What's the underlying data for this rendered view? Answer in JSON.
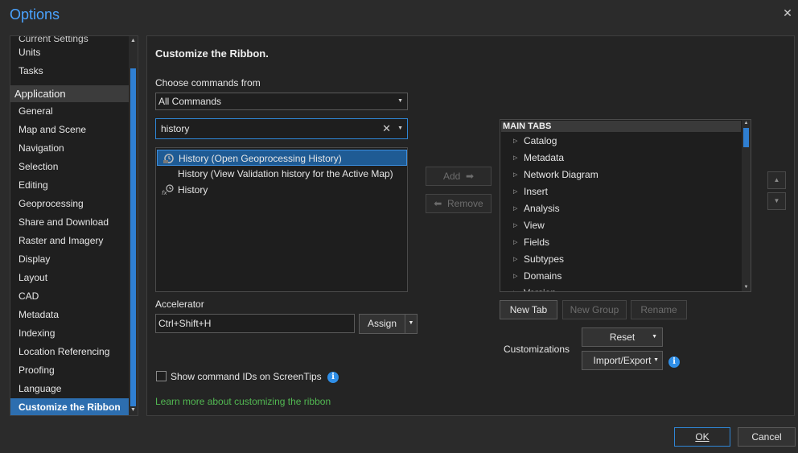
{
  "window": {
    "title": "Options",
    "close_glyph": "✕"
  },
  "nav": {
    "items_top": [
      "Current Settings",
      "Units",
      "Tasks"
    ],
    "header": "Application",
    "items": [
      "General",
      "Map and Scene",
      "Navigation",
      "Selection",
      "Editing",
      "Geoprocessing",
      "Share and Download",
      "Raster and Imagery",
      "Display",
      "Layout",
      "CAD",
      "Metadata",
      "Indexing",
      "Location Referencing",
      "Proofing",
      "Language",
      "Customize the Ribbon"
    ],
    "selected": "Customize the Ribbon"
  },
  "main": {
    "heading": "Customize the Ribbon.",
    "choose_label": "Choose commands from",
    "choose_value": "All Commands",
    "search_value": "history",
    "commands": [
      {
        "text": "History (Open Geoprocessing History)",
        "icon": "geoprocessing-history-icon",
        "selected": true
      },
      {
        "text": "History (View Validation history for the Active Map)",
        "icon": "",
        "selected": false
      },
      {
        "text": "History",
        "icon": "fx-history-icon",
        "selected": false
      }
    ],
    "add_label": "Add",
    "remove_label": "Remove",
    "accelerator_label": "Accelerator",
    "accelerator_value": "Ctrl+Shift+H",
    "assign_label": "Assign",
    "show_ids_label": "Show command IDs on ScreenTips",
    "learn_more": "Learn more about customizing the ribbon",
    "tree_header": "MAIN TABS",
    "tree_items": [
      "Catalog",
      "Metadata",
      "Network Diagram",
      "Insert",
      "Analysis",
      "View",
      "Fields",
      "Subtypes",
      "Domains",
      "Version"
    ],
    "new_tab": "New Tab",
    "new_group": "New Group",
    "rename": "Rename",
    "customizations_label": "Customizations",
    "reset_label": "Reset",
    "import_export_label": "Import/Export"
  },
  "footer": {
    "ok": "OK",
    "cancel": "Cancel"
  },
  "colors": {
    "accent": "#2f86d6",
    "title": "#4aa3ff",
    "link": "#52b852",
    "selection": "#2d6eaf"
  }
}
